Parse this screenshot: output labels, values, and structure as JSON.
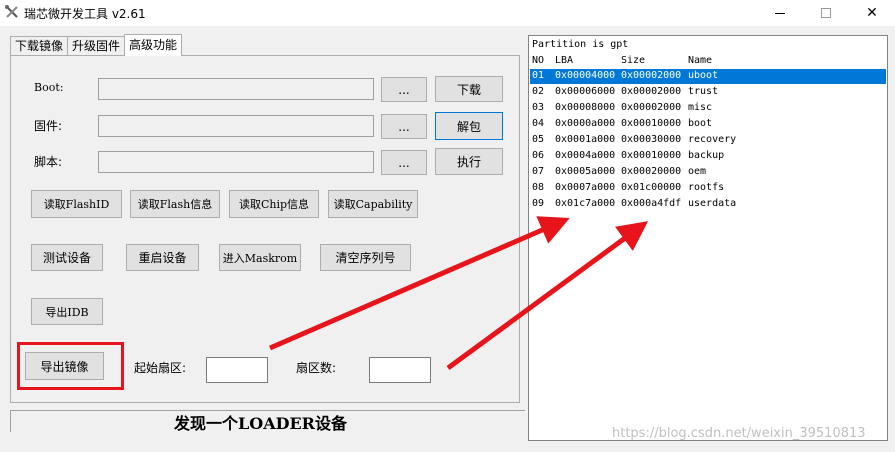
{
  "window": {
    "title": "瑞芯微开发工具 v2.61",
    "close_glyph": "✕"
  },
  "tabs": [
    {
      "label": "下载镜像",
      "active": false
    },
    {
      "label": "升级固件",
      "active": false
    },
    {
      "label": "高级功能",
      "active": true
    }
  ],
  "fields": {
    "boot_label": "Boot:",
    "firmware_label": "固件:",
    "script_label": "脚本:",
    "browse_label": "...",
    "download_label": "下载",
    "unpack_label": "解包",
    "execute_label": "执行"
  },
  "actions": {
    "read_flash_id": "读取FlashID",
    "read_flash_info": "读取Flash信息",
    "read_chip_info": "读取Chip信息",
    "read_capability": "读取Capability",
    "test_device": "测试设备",
    "reset_device": "重启设备",
    "enter_maskrom": "进入Maskrom",
    "clear_serial": "清空序列号",
    "export_idb": "导出IDB",
    "export_image": "导出镜像",
    "start_sector_label": "起始扇区:",
    "sector_count_label": "扇区数:"
  },
  "status": {
    "text": "发现一个LOADER设备"
  },
  "partition_table": {
    "header": "Partition is gpt",
    "columns": [
      "NO",
      "LBA",
      "Size",
      "Name"
    ],
    "rows": [
      {
        "no": "01",
        "lba": "0x00004000",
        "size": "0x00002000",
        "name": "uboot",
        "selected": true
      },
      {
        "no": "02",
        "lba": "0x00006000",
        "size": "0x00002000",
        "name": "trust",
        "selected": false
      },
      {
        "no": "03",
        "lba": "0x00008000",
        "size": "0x00002000",
        "name": "misc",
        "selected": false
      },
      {
        "no": "04",
        "lba": "0x0000a000",
        "size": "0x00010000",
        "name": "boot",
        "selected": false
      },
      {
        "no": "05",
        "lba": "0x0001a000",
        "size": "0x00030000",
        "name": "recovery",
        "selected": false
      },
      {
        "no": "06",
        "lba": "0x0004a000",
        "size": "0x00010000",
        "name": "backup",
        "selected": false
      },
      {
        "no": "07",
        "lba": "0x0005a000",
        "size": "0x00020000",
        "name": "oem",
        "selected": false
      },
      {
        "no": "08",
        "lba": "0x0007a000",
        "size": "0x01c00000",
        "name": "rootfs",
        "selected": false
      },
      {
        "no": "09",
        "lba": "0x01c7a000",
        "size": "0x000a4fdf",
        "name": "userdata",
        "selected": false
      }
    ]
  },
  "watermark": "https://blog.csdn.net/weixin_39510813",
  "colors": {
    "selection": "#0078d7",
    "annotation_red": "#e8141b"
  }
}
